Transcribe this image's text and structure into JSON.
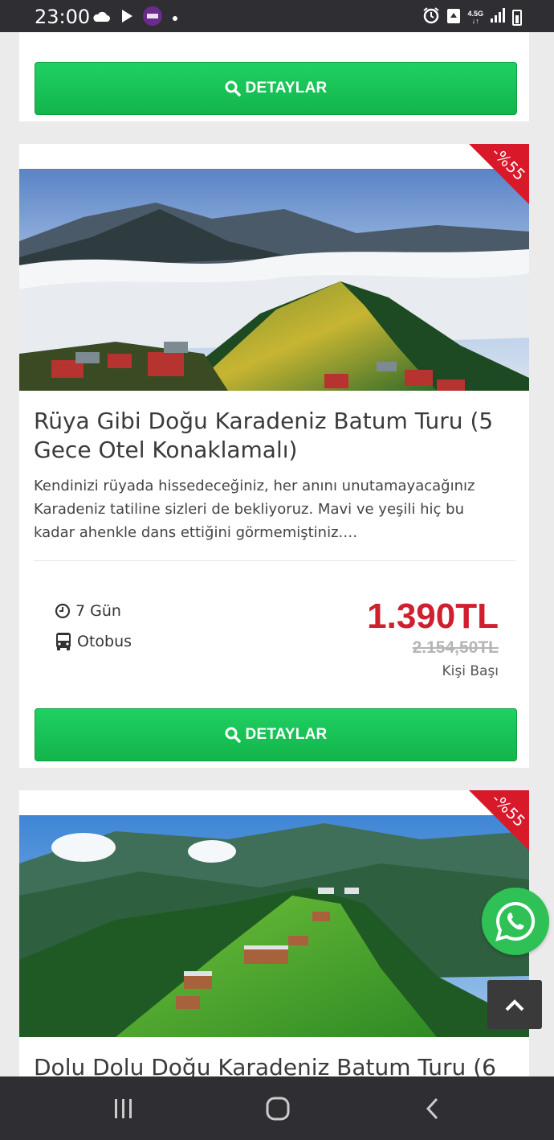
{
  "status_bar": {
    "time": "23:00",
    "network": "4.5G",
    "icons": [
      "cloud-icon",
      "play-icon",
      "bein-sports-icon",
      "dot-icon",
      "alarm-icon",
      "recycle-icon",
      "signal-icon",
      "battery-icon"
    ]
  },
  "colors": {
    "button_green": "#19c157",
    "price_red": "#d01f2f",
    "discount_red": "#d8192a",
    "whatsapp_green": "#2fc156"
  },
  "top_card": {
    "button_label": "DETAYLAR"
  },
  "tours": [
    {
      "discount": "-%55",
      "title": "Rüya Gibi Doğu Karadeniz Batum Turu (5 Gece Otel Konaklamalı)",
      "description": "Kendinizi rüyada hissedeceğiniz, her anını unutamayacağınız Karadeniz tatiline sizleri de bekliyoruz. Mavi ve yeşili hiç bu kadar ahenkle dans ettiğini görmemiştiniz.…",
      "duration": "7 Gün",
      "transport": "Otobus",
      "price": "1.390TL",
      "old_price": "2.154,50TL",
      "price_note": "Kişi Başı",
      "button_label": "DETAYLAR"
    },
    {
      "discount": "-%55",
      "title": "Dolu Dolu Doğu Karadeniz Batum Turu (6"
    }
  ]
}
